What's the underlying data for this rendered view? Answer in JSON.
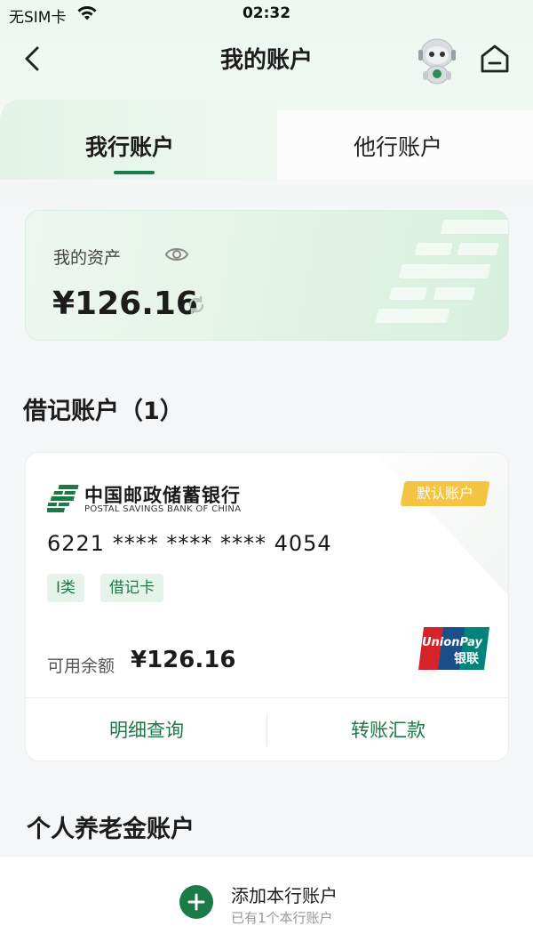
{
  "status_bar": {
    "carrier": "无SIM卡",
    "time": "02:32"
  },
  "nav": {
    "title": "我的账户"
  },
  "tabs": [
    {
      "label": "我行账户",
      "active": true
    },
    {
      "label": "他行账户",
      "active": false
    }
  ],
  "assets": {
    "label": "我的资产",
    "value": "¥126.16"
  },
  "debit_section": {
    "title": "借记账户（1）"
  },
  "card": {
    "bank_name_cn": "中国邮政储蓄银行",
    "bank_name_en": "POSTAL SAVINGS BANK OF CHINA",
    "default_badge": "默认账户",
    "number": "6221 **** **** **** 4054",
    "tags": [
      "I类",
      "借记卡"
    ],
    "balance_label": "可用余额",
    "balance_value": "¥126.16",
    "actions": [
      "明细查询",
      "转账汇款"
    ],
    "unionpay_text_en": "UnionPay",
    "unionpay_text_cn": "银联"
  },
  "pension_section": {
    "title": "个人养老金账户",
    "add_title": "添加本行账户",
    "add_subtitle": "已有1个本行账户"
  },
  "colors": {
    "brand_green": "#1b7a46",
    "badge_yellow": "#f5c542",
    "unionpay_red": "#d6232a",
    "unionpay_blue": "#1a4f8a",
    "unionpay_teal": "#00837b"
  },
  "icons": [
    "wifi-icon",
    "back-arrow-icon",
    "robot-assistant-icon",
    "home-icon",
    "eye-icon",
    "refresh-icon",
    "postal-bank-logo-icon",
    "unionpay-logo-icon",
    "plus-icon"
  ]
}
